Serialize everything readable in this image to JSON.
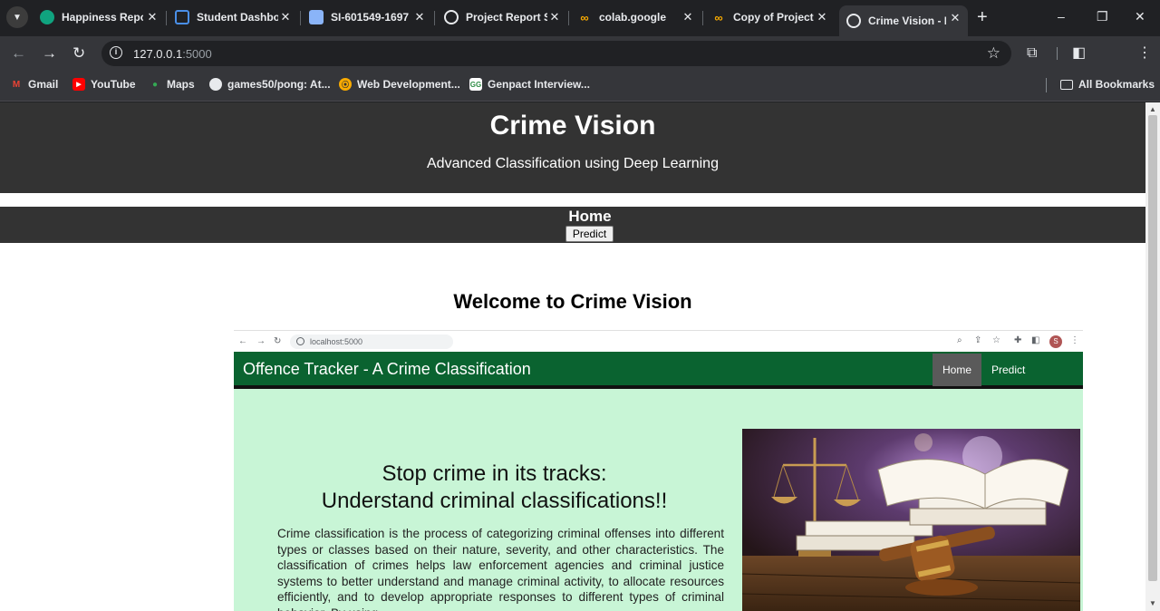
{
  "browser": {
    "tabs": [
      {
        "title": "Happiness Repo",
        "icon": "openai-icon"
      },
      {
        "title": "Student Dashbo",
        "icon": "dashboard-icon"
      },
      {
        "title": "SI-601549-1697",
        "icon": "doc-icon"
      },
      {
        "title": "Project Report S",
        "icon": "globe-icon"
      },
      {
        "title": "colab.google",
        "icon": "colab-icon"
      },
      {
        "title": "Copy of Project",
        "icon": "colab-icon"
      },
      {
        "title": "Crime Vision - H",
        "icon": "globe-icon",
        "active": true
      }
    ],
    "url_host": "127.0.0.1",
    "url_port": ":5000",
    "bookmarks": [
      "Gmail",
      "YouTube",
      "Maps",
      "games50/pong: At...",
      "Web Development...",
      "Genpact Interview..."
    ],
    "all_bookmarks": "All Bookmarks"
  },
  "site": {
    "title": "Crime Vision",
    "subtitle": "Advanced Classification using Deep Learning",
    "nav_home": "Home",
    "nav_predict": "Predict",
    "welcome": "Welcome to Crime Vision"
  },
  "embedded": {
    "url": "localhost:5000",
    "avatar_letter": "S",
    "brand": "Offence Tracker - A Crime Classification",
    "nav_home": "Home",
    "nav_predict": "Predict",
    "headline_line1": "Stop crime in its tracks:",
    "headline_line2": "Understand criminal classifications!!",
    "paragraph": "Crime classification is the process of categorizing criminal offenses into different types or classes based on their nature, severity, and other characteristics. The classification of crimes helps law enforcement agencies and criminal justice systems to better understand and manage criminal activity, to allocate resources efficiently, and to develop appropriate responses to different types of criminal behavior. By using"
  },
  "colors": {
    "header_bg": "#333333",
    "embedded_nav": "#0a6330",
    "embedded_bg": "#c8f5d6"
  }
}
